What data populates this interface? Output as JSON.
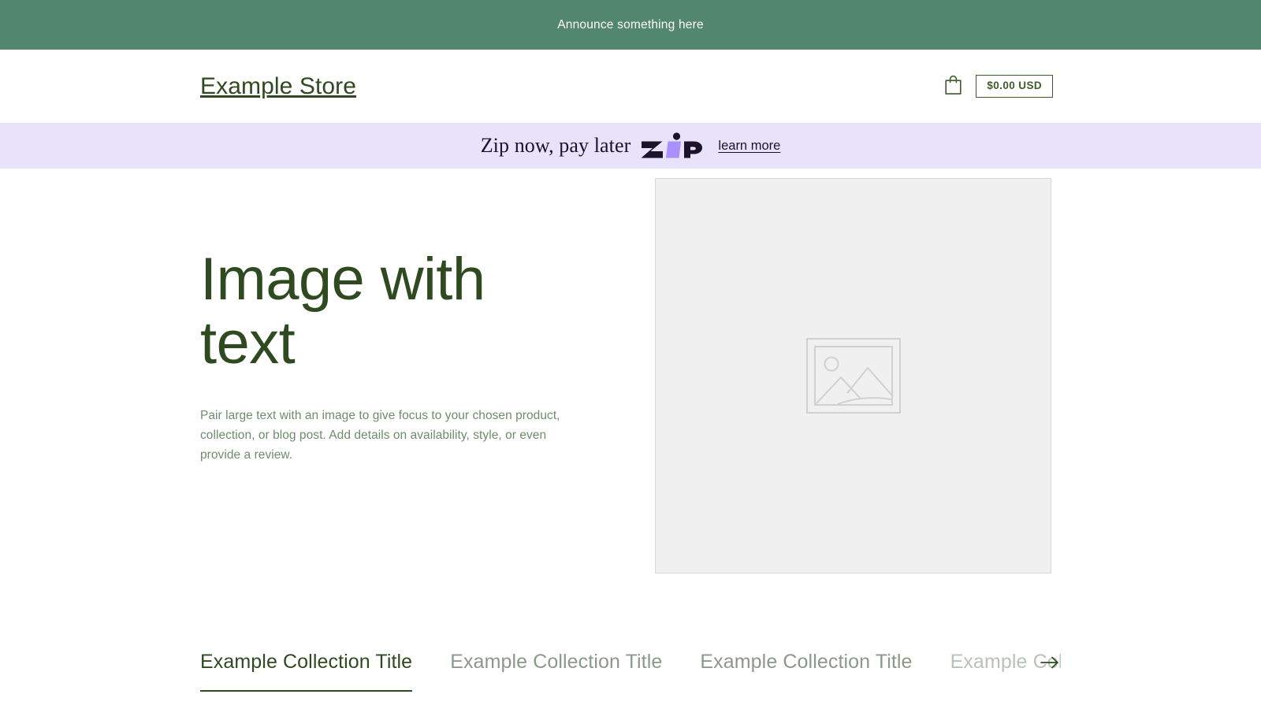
{
  "announcement": {
    "text": "Announce something here",
    "background": "#52866e",
    "text_color": "#ffffff"
  },
  "header": {
    "store_name": "Example Store",
    "cart_icon": "shopping-bag-icon",
    "cart_total": "$0.00 USD",
    "accent_color": "#2f4a20"
  },
  "zip_banner": {
    "tagline": "Zip now, pay later",
    "logo_text": "zip",
    "learn_more": "learn more",
    "background": "#e8e2fb",
    "logo_dark": "#1d1328",
    "logo_purple": "#aa8fff"
  },
  "hero": {
    "heading": "Image with text",
    "body": "Pair large text with an image to give focus to your chosen product, collection, or blog post. Add details on availability, style, or even provide a review.",
    "heading_color": "#2f4a20",
    "body_color": "#6f8c6d",
    "media": {
      "placeholder_icon": "image-placeholder-icon",
      "background": "#f0f0f0",
      "border_color": "#d9d9d9"
    }
  },
  "collections": {
    "tabs": [
      {
        "label": "Example Collection Title",
        "active": true
      },
      {
        "label": "Example Collection Title",
        "active": false
      },
      {
        "label": "Example Collection Title",
        "active": false
      },
      {
        "label": "Example Collection Title",
        "active": false
      }
    ],
    "next_icon": "arrow-right-icon",
    "active_color": "#2f4a20",
    "inactive_color": "#8a9a8a"
  }
}
